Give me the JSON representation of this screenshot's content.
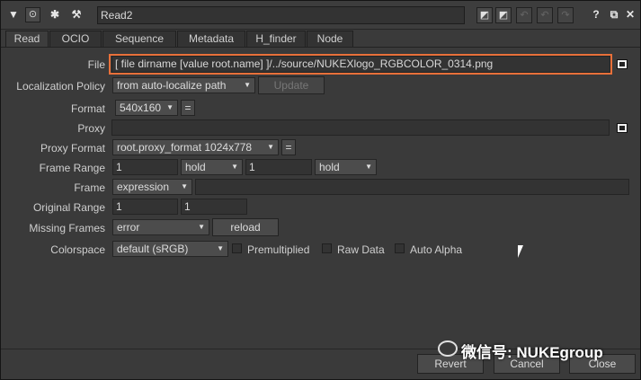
{
  "toolbar": {
    "node_name": "Read2",
    "icons": [
      "collapse-arrow-icon",
      "node-dot-icon",
      "bug-icon",
      "wrench-icon",
      "swatch-icon",
      "swatch-icon",
      "undo-icon",
      "redo-icon",
      "help-icon",
      "float-icon",
      "close-icon"
    ],
    "help_glyph": "?",
    "float_glyph": "⧉",
    "close_glyph": "✕"
  },
  "tabs": [
    "Read",
    "OCIO",
    "Sequence",
    "Metadata",
    "H_finder",
    "Node"
  ],
  "form": {
    "file_label": "File",
    "file_value": "[ file dirname [value root.name] ]/../source/NUKEXlogo_RGBCOLOR_0314.png",
    "localization_label": "Localization Policy",
    "localization_value": "from auto-localize path",
    "update_label": "Update",
    "format_label": "Format",
    "format_value": "540x160",
    "eq_glyph": "=",
    "proxy_label": "Proxy",
    "proxy_value": "",
    "proxy_format_label": "Proxy Format",
    "proxy_format_value": "root.proxy_format 1024x778",
    "frame_range_label": "Frame Range",
    "frame_range_start": "1",
    "frame_range_before": "hold",
    "frame_range_end": "1",
    "frame_range_after": "hold",
    "frame_label": "Frame",
    "frame_mode": "expression",
    "frame_value": "",
    "original_range_label": "Original Range",
    "original_range_start": "1",
    "original_range_end": "1",
    "missing_frames_label": "Missing Frames",
    "missing_frames_value": "error",
    "reload_label": "reload",
    "colorspace_label": "Colorspace",
    "colorspace_value": "default (sRGB)",
    "premultiplied_label": "Premultiplied",
    "raw_data_label": "Raw Data",
    "auto_alpha_label": "Auto Alpha"
  },
  "footer": {
    "revert_label": "Revert",
    "cancel_label": "Cancel",
    "close_label": "Close"
  },
  "watermark": "微信号: NUKEgroup",
  "colors": {
    "highlight": "#e8703a",
    "panel": "#3a3a3a"
  }
}
